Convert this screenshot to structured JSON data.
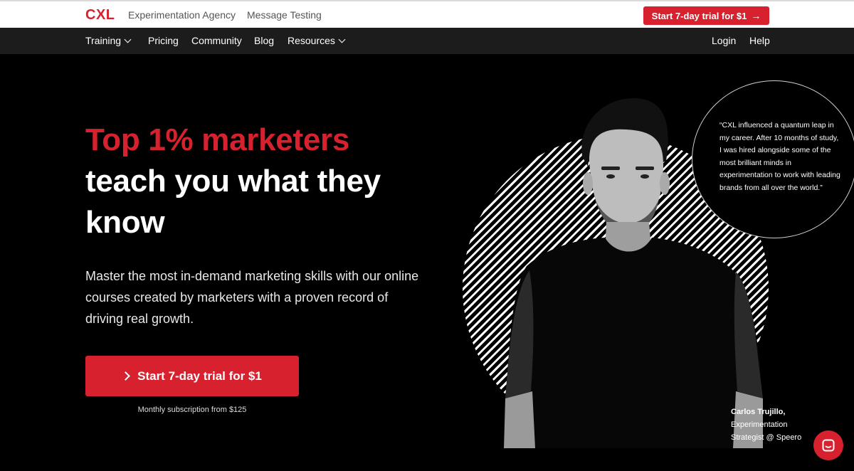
{
  "brand": {
    "logo_text": "CXL",
    "accent_color": "#d8212f"
  },
  "topbar": {
    "links": [
      "Experimentation Agency",
      "Message Testing"
    ],
    "cta_label": "Start 7-day trial for $1",
    "cta_icon": "arrow-right-icon"
  },
  "nav": {
    "items": [
      {
        "label": "Training",
        "has_dropdown": true
      },
      {
        "label": "Pricing"
      },
      {
        "label": "Community"
      },
      {
        "label": "Blog"
      },
      {
        "label": "Resources",
        "has_dropdown": true
      }
    ],
    "right": [
      "Login",
      "Help"
    ]
  },
  "hero": {
    "headline_red": "Top 1% marketers",
    "headline_white_1": "teach you what they",
    "headline_white_2": "know",
    "lead": "Master the most in-demand marketing skills with our online courses created by marketers with a proven record of driving real growth.",
    "cta_label": "Start 7-day trial for $1",
    "subnote": "Monthly subscription from $125"
  },
  "testimonial": {
    "quote": "“CXL influenced a quantum leap in my career. After 10 months of study, I was hired alongside some of the most brilliant minds in experimentation to work with leading brands from all over the world.”",
    "name": "Carlos Trujillo,",
    "role": "Experimentation Strategist @ Speero"
  },
  "chat": {
    "icon": "chat-icon"
  }
}
